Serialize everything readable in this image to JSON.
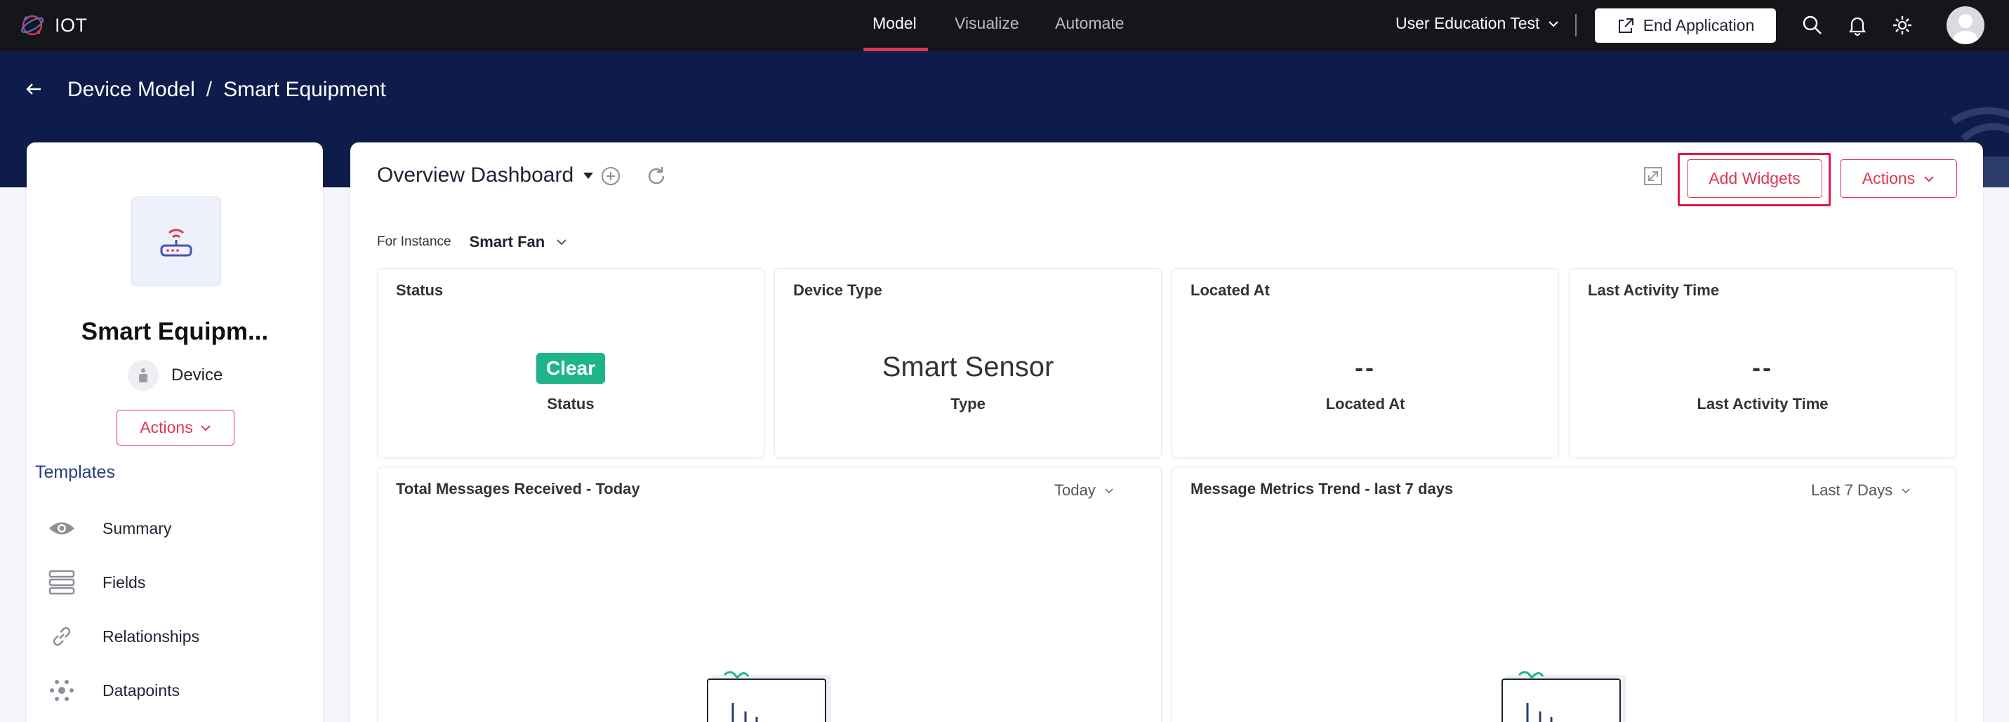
{
  "app": {
    "name": "IOT"
  },
  "nav": {
    "tabs": [
      "Model",
      "Visualize",
      "Automate"
    ],
    "active": "Model"
  },
  "header": {
    "user": "User Education Test",
    "end_app_label": "End Application"
  },
  "breadcrumb": {
    "parent": "Device Model",
    "separator": "/",
    "current": "Smart Equipment"
  },
  "sidebar": {
    "name": "Smart Equipm...",
    "type": "Device",
    "actions_label": "Actions",
    "templates_title": "Templates",
    "items": [
      {
        "label": "Summary",
        "icon": "eye-icon"
      },
      {
        "label": "Fields",
        "icon": "fields-icon"
      },
      {
        "label": "Relationships",
        "icon": "link-icon"
      },
      {
        "label": "Datapoints",
        "icon": "datapoints-icon"
      }
    ]
  },
  "dashboard": {
    "title": "Overview Dashboard",
    "add_widgets_label": "Add Widgets",
    "actions_label": "Actions",
    "for_instance_label": "For Instance",
    "instance": "Smart Fan"
  },
  "cards": [
    {
      "title": "Status",
      "value": "Clear",
      "sublabel": "Status"
    },
    {
      "title": "Device Type",
      "value": "Smart Sensor",
      "sublabel": "Type"
    },
    {
      "title": "Located At",
      "value": "--",
      "sublabel": "Located At"
    },
    {
      "title": "Last Activity Time",
      "value": "--",
      "sublabel": "Last Activity Time"
    }
  ],
  "widgets": [
    {
      "title": "Total Messages Received - Today",
      "range": "Today"
    },
    {
      "title": "Message Metrics Trend - last 7 days",
      "range": "Last 7 Days"
    }
  ],
  "colors": {
    "accent": "#e0364f",
    "hero": "#0d1c4a",
    "status_clear": "#1fb58b",
    "topbar": "#15161a"
  }
}
